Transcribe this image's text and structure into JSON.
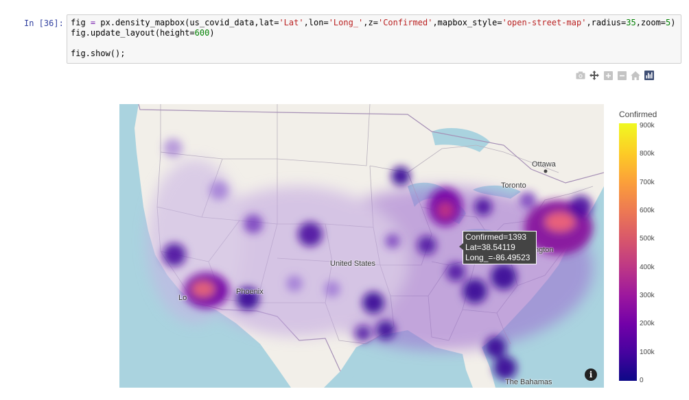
{
  "cell": {
    "prompt": "In [36]:",
    "code_lines": [
      [
        {
          "t": "fig ",
          "c": "kw"
        },
        {
          "t": "=",
          "c": "op"
        },
        {
          "t": " px.density_mapbox(us_covid_data,lat=",
          "c": "kw"
        },
        {
          "t": "'Lat'",
          "c": "str"
        },
        {
          "t": ",lon=",
          "c": "kw"
        },
        {
          "t": "'Long_'",
          "c": "str"
        },
        {
          "t": ",z=",
          "c": "kw"
        },
        {
          "t": "'Confirmed'",
          "c": "str"
        },
        {
          "t": ",mapbox_style=",
          "c": "kw"
        },
        {
          "t": "'open-street-map'",
          "c": "str"
        },
        {
          "t": ",radius=",
          "c": "kw"
        },
        {
          "t": "35",
          "c": "num"
        },
        {
          "t": ",zoom=",
          "c": "kw"
        },
        {
          "t": "5",
          "c": "num"
        },
        {
          "t": ")",
          "c": "kw"
        }
      ],
      [
        {
          "t": "fig.update_layout(height=",
          "c": "kw"
        },
        {
          "t": "600",
          "c": "num"
        },
        {
          "t": ")",
          "c": "kw"
        }
      ],
      [
        {
          "t": "",
          "c": "kw"
        }
      ],
      [
        {
          "t": "fig.show();",
          "c": "kw"
        }
      ]
    ]
  },
  "modebar": {
    "icons": [
      "camera-icon",
      "pan-icon",
      "zoom-in-icon",
      "zoom-out-icon",
      "home-icon",
      "plotly-logo-icon"
    ]
  },
  "map": {
    "labels": {
      "ottawa": "Ottawa",
      "toronto": "Toronto",
      "united_states": "United States",
      "phoenix": "Phoenix",
      "los": "Lo",
      "washington": "ngton",
      "bahamas": "The Bahamas"
    },
    "colors": {
      "water": "#aad3df",
      "land": "#f2efe9"
    }
  },
  "colorbar": {
    "title": "Confirmed",
    "ticks": [
      "900k",
      "800k",
      "700k",
      "600k",
      "500k",
      "400k",
      "300k",
      "200k",
      "100k",
      "0"
    ]
  },
  "tooltip": {
    "line1": "Confirmed=1393",
    "line2": "Lat=38.54119",
    "line3": "Long_=-86.49523"
  }
}
